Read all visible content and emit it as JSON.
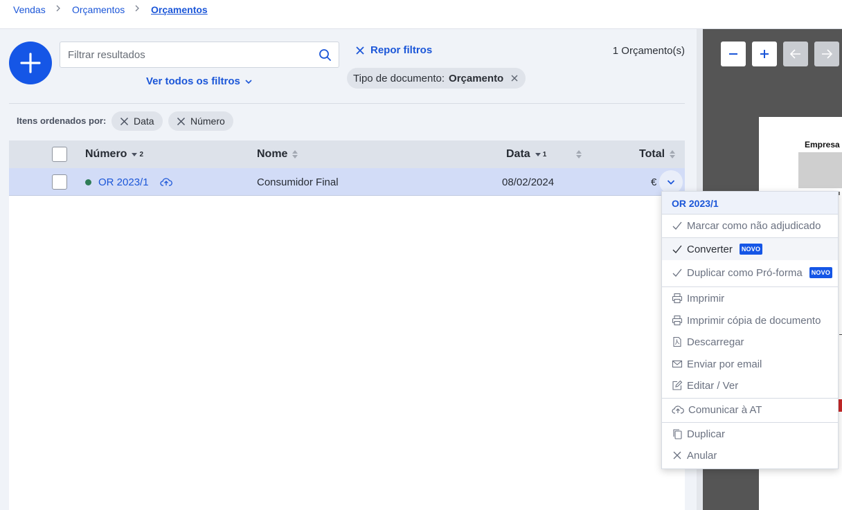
{
  "breadcrumb": {
    "items": [
      "Vendas",
      "Orçamentos"
    ],
    "current": "Orçamentos"
  },
  "toolbar": {
    "search_placeholder": "Filtrar resultados",
    "all_filters_label": "Ver todos os filtros",
    "reset_filters_label": "Repor filtros",
    "result_count": "1 Orçamento(s)",
    "doc_type_chip": {
      "label": "Tipo de documento:",
      "value": "Orçamento"
    }
  },
  "sorting": {
    "label": "Itens ordenados por:",
    "chips": [
      "Data",
      "Número"
    ]
  },
  "table": {
    "headers": {
      "number": "Número",
      "number_sort_order": "2",
      "name": "Nome",
      "date": "Data",
      "date_sort_order": "1",
      "total": "Total"
    },
    "rows": [
      {
        "number": "OR 2023/1",
        "status_color": "#2f7d57",
        "name": "Consumidor Final",
        "date": "08/02/2024",
        "total": "€"
      }
    ]
  },
  "menu": {
    "title": "OR 2023/1",
    "items": [
      {
        "label": "Marcar como não adjudicado",
        "icon": "check-icon"
      },
      {
        "label": "Converter",
        "icon": "check-icon",
        "badge": "NOVO"
      },
      {
        "label": "Duplicar como Pró-forma",
        "icon": "check-icon",
        "badge": "NOVO"
      },
      {
        "label": "Imprimir",
        "icon": "printer-icon"
      },
      {
        "label": "Imprimir cópia de documento",
        "icon": "printer-icon"
      },
      {
        "label": "Descarregar",
        "icon": "pdf-icon"
      },
      {
        "label": "Enviar por email",
        "icon": "mail-icon"
      },
      {
        "label": "Editar / Ver",
        "icon": "edit-icon"
      },
      {
        "label": "Comunicar à AT",
        "icon": "cloud-upload-icon"
      },
      {
        "label": "Duplicar",
        "icon": "copy-icon"
      },
      {
        "label": "Anular",
        "icon": "close-icon"
      }
    ]
  },
  "preview": {
    "company_label": "Empresa"
  },
  "colors": {
    "accent": "#1556e6",
    "link": "#1b56d8",
    "selected_row": "#d2dcf7"
  }
}
